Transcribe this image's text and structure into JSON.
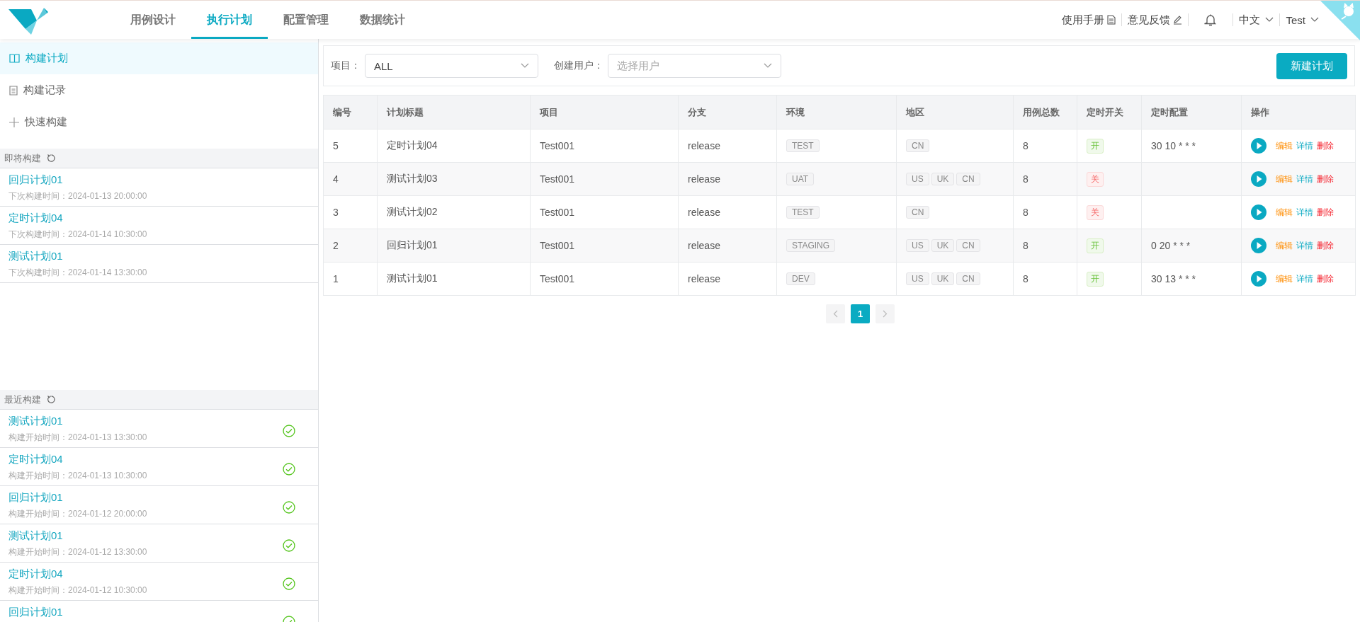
{
  "header": {
    "nav": [
      {
        "label": "用例设计",
        "selected": false
      },
      {
        "label": "执行计划",
        "selected": true
      },
      {
        "label": "配置管理",
        "selected": false
      },
      {
        "label": "数据统计",
        "selected": false
      }
    ],
    "links": [
      {
        "label": "使用手册",
        "kind": "manual"
      },
      {
        "label": "意见反馈",
        "kind": "feedback"
      }
    ],
    "language": "中文",
    "user": "Test"
  },
  "sidebar": {
    "menu": [
      {
        "label": "构建计划",
        "kind": "book",
        "selected": true
      },
      {
        "label": "构建记录",
        "kind": "doc",
        "selected": false
      },
      {
        "label": "快速构建",
        "kind": "plus",
        "selected": false
      }
    ],
    "upcoming": {
      "title": "即将构建",
      "items": [
        {
          "name": "回归计划01",
          "time": "下次构建时间：2024-01-13 20:00:00"
        },
        {
          "name": "定时计划04",
          "time": "下次构建时间：2024-01-14 10:30:00"
        },
        {
          "name": "测试计划01",
          "time": "下次构建时间：2024-01-14 13:30:00"
        }
      ]
    },
    "recent": {
      "title": "最近构建",
      "items": [
        {
          "name": "测试计划01",
          "time": "构建开始时间：2024-01-13 13:30:00",
          "succeeded": true
        },
        {
          "name": "定时计划04",
          "time": "构建开始时间：2024-01-13 10:30:00",
          "succeeded": true
        },
        {
          "name": "回归计划01",
          "time": "构建开始时间：2024-01-12 20:00:00",
          "succeeded": true
        },
        {
          "name": "测试计划01",
          "time": "构建开始时间：2024-01-12 13:30:00",
          "succeeded": true
        },
        {
          "name": "定时计划04",
          "time": "构建开始时间：2024-01-12 10:30:00",
          "succeeded": true
        },
        {
          "name": "回归计划01",
          "succeeded": true
        }
      ]
    }
  },
  "filters": [
    {
      "label": "项目：",
      "value": "ALL"
    },
    {
      "label": "创建用户：",
      "placeholder": "选择用户"
    }
  ],
  "new_button": "新建计划",
  "table": {
    "columns": [
      "编号",
      "计划标题",
      "项目",
      "分支",
      "环境",
      "地区",
      "用例总数",
      "定时开关",
      "定时配置",
      "操作"
    ],
    "rows": [
      {
        "id": "5",
        "title": "定时计划04",
        "project": "Test001",
        "branch": "release",
        "env": "TEST",
        "regions": [
          "CN"
        ],
        "cases": "8",
        "timer": {
          "label": "开",
          "on": true
        },
        "cron": "30 10 * * *",
        "actions": [
          {
            "label": "编辑",
            "kind": "edit"
          },
          {
            "label": "详情",
            "kind": "detail"
          },
          {
            "label": "删除",
            "kind": "delete"
          }
        ]
      },
      {
        "id": "4",
        "title": "测试计划03",
        "project": "Test001",
        "branch": "release",
        "env": "UAT",
        "regions": [
          "US",
          "UK",
          "CN"
        ],
        "cases": "8",
        "timer": {
          "label": "关",
          "on": false
        },
        "actions": [
          {
            "label": "编辑",
            "kind": "edit"
          },
          {
            "label": "详情",
            "kind": "detail"
          },
          {
            "label": "删除",
            "kind": "delete"
          }
        ]
      },
      {
        "id": "3",
        "title": "测试计划02",
        "project": "Test001",
        "branch": "release",
        "env": "TEST",
        "regions": [
          "CN"
        ],
        "cases": "8",
        "timer": {
          "label": "关",
          "on": false
        },
        "actions": [
          {
            "label": "编辑",
            "kind": "edit"
          },
          {
            "label": "详情",
            "kind": "detail"
          },
          {
            "label": "删除",
            "kind": "delete"
          }
        ]
      },
      {
        "id": "2",
        "title": "回归计划01",
        "project": "Test001",
        "branch": "release",
        "env": "STAGING",
        "regions": [
          "US",
          "UK",
          "CN"
        ],
        "cases": "8",
        "timer": {
          "label": "开",
          "on": true
        },
        "cron": "0 20 * * *",
        "actions": [
          {
            "label": "编辑",
            "kind": "edit"
          },
          {
            "label": "详情",
            "kind": "detail"
          },
          {
            "label": "删除",
            "kind": "delete"
          }
        ]
      },
      {
        "id": "1",
        "title": "测试计划01",
        "project": "Test001",
        "branch": "release",
        "env": "DEV",
        "regions": [
          "US",
          "UK",
          "CN"
        ],
        "cases": "8",
        "timer": {
          "label": "开",
          "on": true
        },
        "cron": "30 13 * * *",
        "actions": [
          {
            "label": "编辑",
            "kind": "edit"
          },
          {
            "label": "详情",
            "kind": "detail"
          },
          {
            "label": "删除",
            "kind": "delete"
          }
        ]
      }
    ]
  },
  "pagination": {
    "pages": [
      {
        "label": "1",
        "selected": true
      }
    ]
  }
}
